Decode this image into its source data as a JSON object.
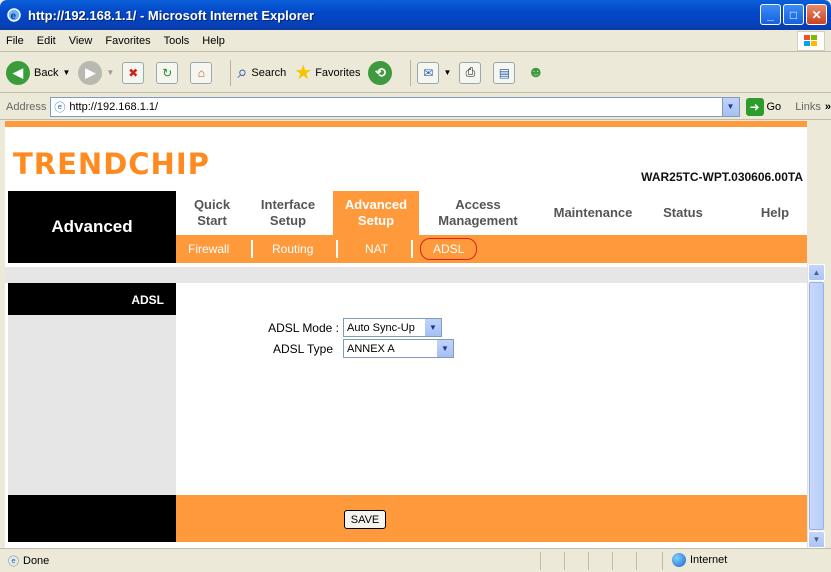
{
  "window": {
    "title": "http://192.168.1.1/ - Microsoft Internet Explorer"
  },
  "menu": [
    "File",
    "Edit",
    "View",
    "Favorites",
    "Tools",
    "Help"
  ],
  "toolbar": {
    "back": "Back",
    "search": "Search",
    "favorites": "Favorites"
  },
  "address": {
    "label": "Address",
    "url": "http://192.168.1.1/",
    "go": "Go",
    "links": "Links"
  },
  "router": {
    "brand": "TRENDCHIP",
    "model": "WAR25TC-WPT.030606.00TA",
    "section": "Advanced",
    "nav": [
      {
        "label1": "Quick",
        "label2": "Start"
      },
      {
        "label1": "Interface",
        "label2": "Setup"
      },
      {
        "label1": "Advanced",
        "label2": "Setup"
      },
      {
        "label1": "Access",
        "label2": "Management"
      },
      {
        "label1": "Maintenance",
        "label2": ""
      },
      {
        "label1": "Status",
        "label2": ""
      },
      {
        "label1": "Help",
        "label2": ""
      }
    ],
    "subnav": [
      "Firewall",
      "Routing",
      "NAT",
      "ADSL"
    ],
    "panel_title": "ADSL",
    "adsl_mode_label": "ADSL Mode :",
    "adsl_mode_value": "Auto Sync-Up",
    "adsl_type_label": "ADSL Type",
    "adsl_type_value": "ANNEX A",
    "save": "SAVE"
  },
  "status": {
    "text": "Done",
    "zone": "Internet"
  }
}
